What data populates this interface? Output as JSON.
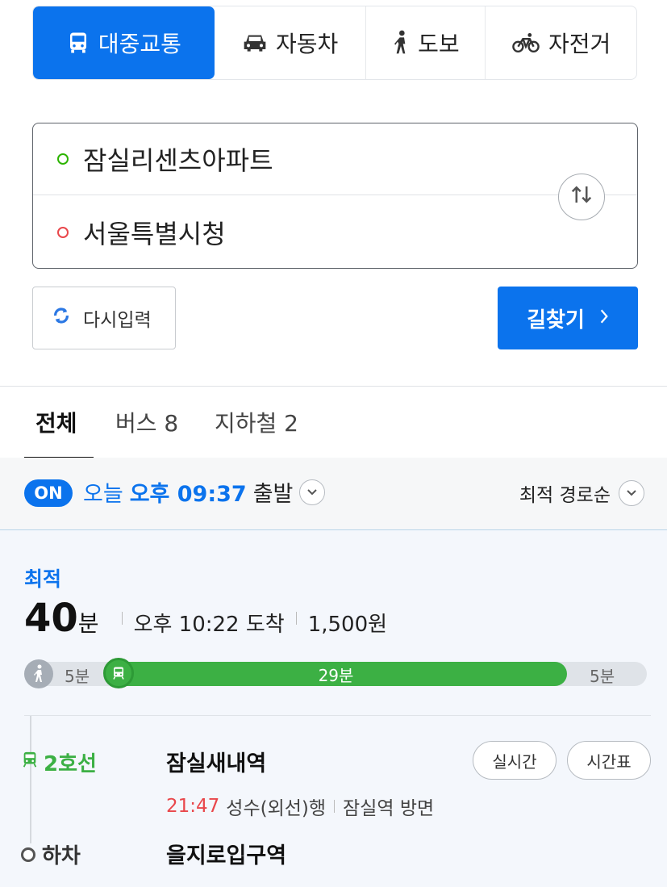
{
  "modes": [
    {
      "label": "대중교통",
      "icon": "bus-icon",
      "active": true
    },
    {
      "label": "자동차",
      "icon": "car-icon",
      "active": false
    },
    {
      "label": "도보",
      "icon": "walk-icon",
      "active": false
    },
    {
      "label": "자전거",
      "icon": "bicycle-icon",
      "active": false
    }
  ],
  "route": {
    "start": "잠실리센츠아파트",
    "end": "서울특별시청"
  },
  "actions": {
    "reset_label": "다시입력",
    "search_label": "길찾기"
  },
  "filter_tabs": [
    {
      "label": "전체",
      "active": true
    },
    {
      "label": "버스 8",
      "active": false
    },
    {
      "label": "지하철 2",
      "active": false
    }
  ],
  "departure": {
    "badge": "ON",
    "day": "오늘",
    "time": "오후 09:37",
    "suffix": "출발"
  },
  "sort": {
    "label": "최적 경로순"
  },
  "result": {
    "tag": "최적",
    "minutes": "40",
    "minutes_unit": "분",
    "arrival": "오후 10:22 도착",
    "fare": "1,500원",
    "segments": {
      "walk1": "5분",
      "transit": "29분",
      "walk2": "5분"
    },
    "line": "2호선",
    "board_station": "잠실새내역",
    "realtime_label": "실시간",
    "timetable_label": "시간표",
    "next_time": "21:47",
    "direction": "성수(외선)행",
    "platform": "잠실역 방면",
    "getoff_label": "하차",
    "alight_station": "을지로입구역"
  },
  "colors": {
    "accent": "#0b73ed",
    "line2_green": "#3cb044",
    "start_dot": "#2db400",
    "end_dot": "#e9474b"
  }
}
